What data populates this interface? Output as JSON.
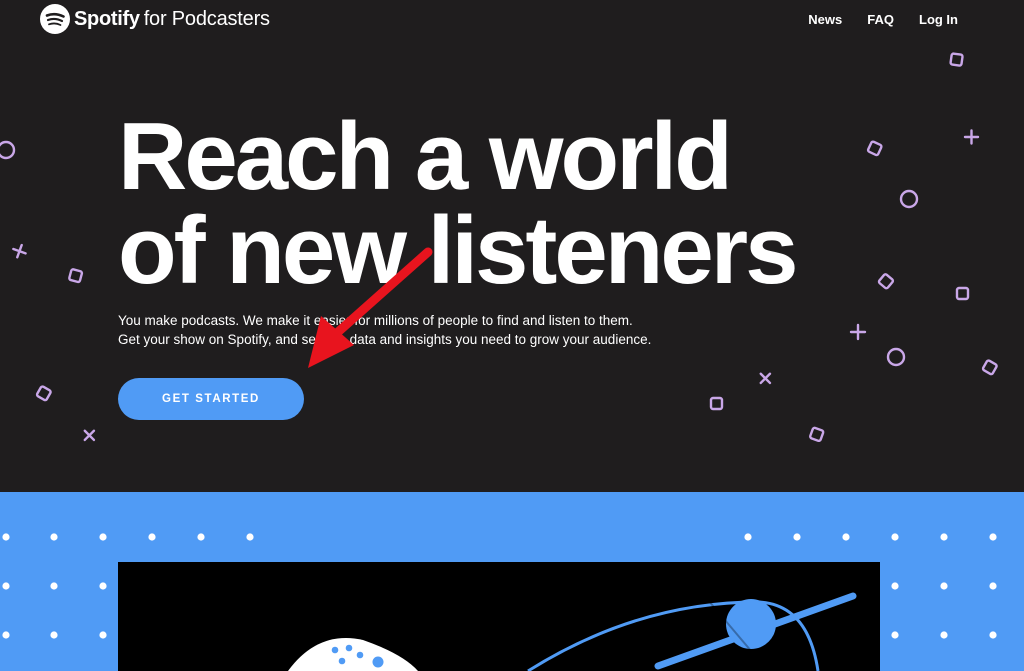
{
  "header": {
    "brand": "Spotify",
    "brand_sub": "for Podcasters",
    "logo_icon": "spotify-logo-icon",
    "nav": [
      {
        "label": "News"
      },
      {
        "label": "FAQ"
      },
      {
        "label": "Log In"
      }
    ]
  },
  "hero": {
    "headline_line1": "Reach a world",
    "headline_line2": "of new listeners",
    "description_line1": "You make podcasts. We make it easier for millions of people to find and listen to them.",
    "description_line2": "Get your show on Spotify, and see the data and insights you need to grow your audience.",
    "cta_label": "GET STARTED"
  },
  "annotation": {
    "icon": "red-arrow-icon",
    "color": "#e8141e"
  },
  "colors": {
    "background": "#1f1d1e",
    "accent_blue": "#509bf5",
    "deco_purple": "#c9a7e8"
  }
}
